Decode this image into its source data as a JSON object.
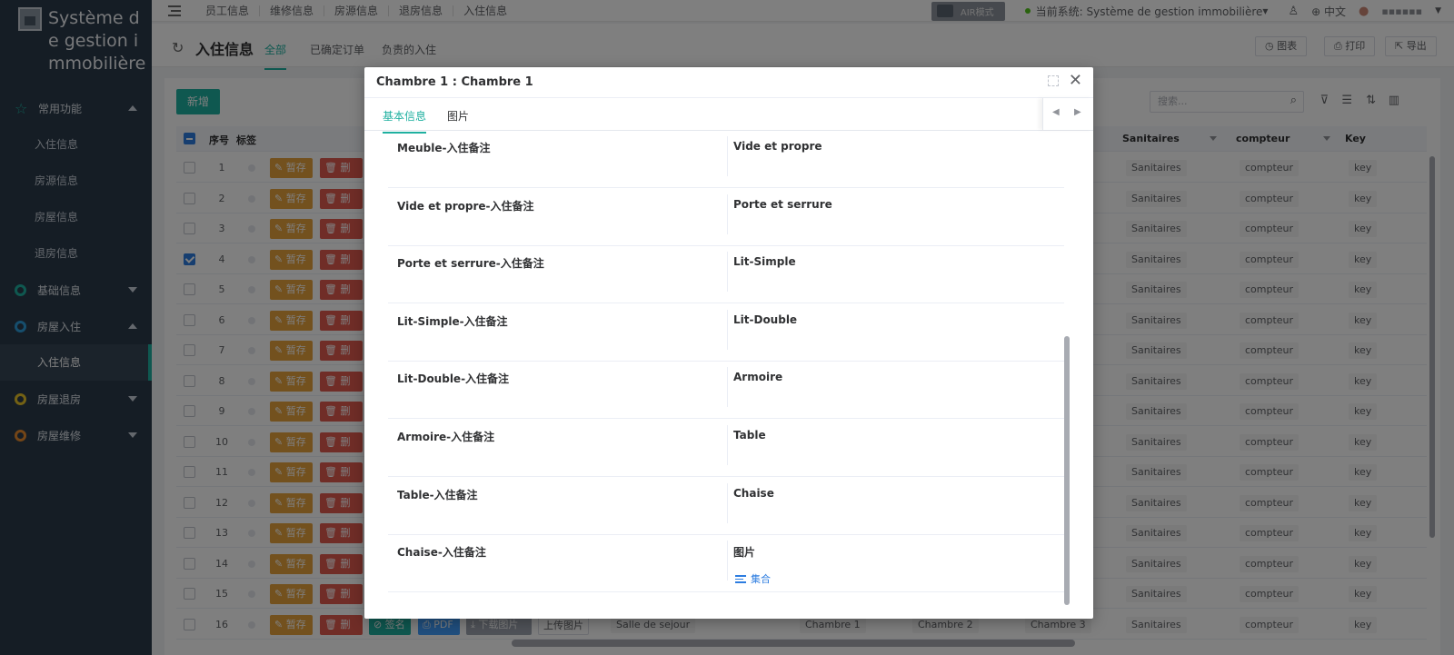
{
  "sidebar": {
    "system_title": "Système de gestion immobilière",
    "groups": [
      {
        "label": "常用功能",
        "expanded": true,
        "items": [
          "入住信息",
          "房源信息",
          "房屋信息",
          "退房信息"
        ]
      },
      {
        "label": "基础信息",
        "expanded": false,
        "items": []
      },
      {
        "label": "房屋入住",
        "expanded": true,
        "items": [
          "入住信息"
        ]
      },
      {
        "label": "房屋退房",
        "expanded": false,
        "items": []
      },
      {
        "label": "房屋维修",
        "expanded": false,
        "items": []
      }
    ],
    "active_item": "入住信息",
    "colors": {
      "bg": "#2b3a4a",
      "accent": "#1fb0a0",
      "yellow": "#e6c229",
      "orange": "#e68a2e"
    }
  },
  "topbar": {
    "links": [
      "员工信息",
      "维修信息",
      "房源信息",
      "退房信息",
      "入住信息"
    ],
    "air_mode": "AIR模式",
    "current_system": "当前系统: Système de gestion immobilière",
    "language": "中文",
    "username": "▪▪▪▪▪▪"
  },
  "page": {
    "title": "入住信息",
    "tabs": [
      "全部",
      "已确定订单",
      "负责的入住"
    ],
    "active_tab": "全部",
    "buttons": {
      "chart": "图表",
      "print": "打印",
      "export": "导出"
    }
  },
  "toolbar": {
    "add_label": "新增",
    "search_placeholder": "搜索..."
  },
  "table": {
    "headers": {
      "index": "序号",
      "tag": "标签",
      "sanitaires": "Sanitaires",
      "compteur": "compteur",
      "key": "Key"
    },
    "row_buttons": {
      "save": "暂存",
      "delete": "删除",
      "sign": "签名",
      "pdf": "PDF",
      "download": "下载图片",
      "upload": "上传图片"
    },
    "rows": [
      {
        "n": "1",
        "checked": false
      },
      {
        "n": "2",
        "checked": false
      },
      {
        "n": "3",
        "checked": false
      },
      {
        "n": "4",
        "checked": true
      },
      {
        "n": "5",
        "checked": false
      },
      {
        "n": "6",
        "checked": false
      },
      {
        "n": "7",
        "checked": false
      },
      {
        "n": "8",
        "checked": false
      },
      {
        "n": "9",
        "checked": false
      },
      {
        "n": "10",
        "checked": false
      },
      {
        "n": "11",
        "checked": false
      },
      {
        "n": "12",
        "checked": false
      },
      {
        "n": "13",
        "checked": false
      },
      {
        "n": "14",
        "checked": false
      },
      {
        "n": "15",
        "checked": false
      },
      {
        "n": "16",
        "checked": false
      }
    ],
    "chips": {
      "sanitaires": "Sanitaires",
      "compteur": "compteur",
      "key": "key"
    },
    "last_row_chips": [
      "Salle de sejour",
      "Chambre 1",
      "Chambre 2",
      "Chambre 3"
    ]
  },
  "modal": {
    "title": "Chambre 1 : Chambre 1",
    "tabs": [
      "基本信息",
      "图片"
    ],
    "active_tab": "基本信息",
    "fields": [
      {
        "left": "Meuble-入住备注",
        "right": "Vide et propre"
      },
      {
        "left": "Vide et propre-入住备注",
        "right": "Porte et serrure"
      },
      {
        "left": "Porte et serrure-入住备注",
        "right": "Lit-Simple"
      },
      {
        "left": "Lit-Simple-入住备注",
        "right": "Lit-Double"
      },
      {
        "left": "Lit-Double-入住备注",
        "right": "Armoire"
      },
      {
        "left": "Armoire-入住备注",
        "right": "Table"
      },
      {
        "left": "Table-入住备注",
        "right": "Chaise"
      },
      {
        "left": "Chaise-入住备注",
        "right": "图片"
      }
    ],
    "collection_link": "集合"
  }
}
